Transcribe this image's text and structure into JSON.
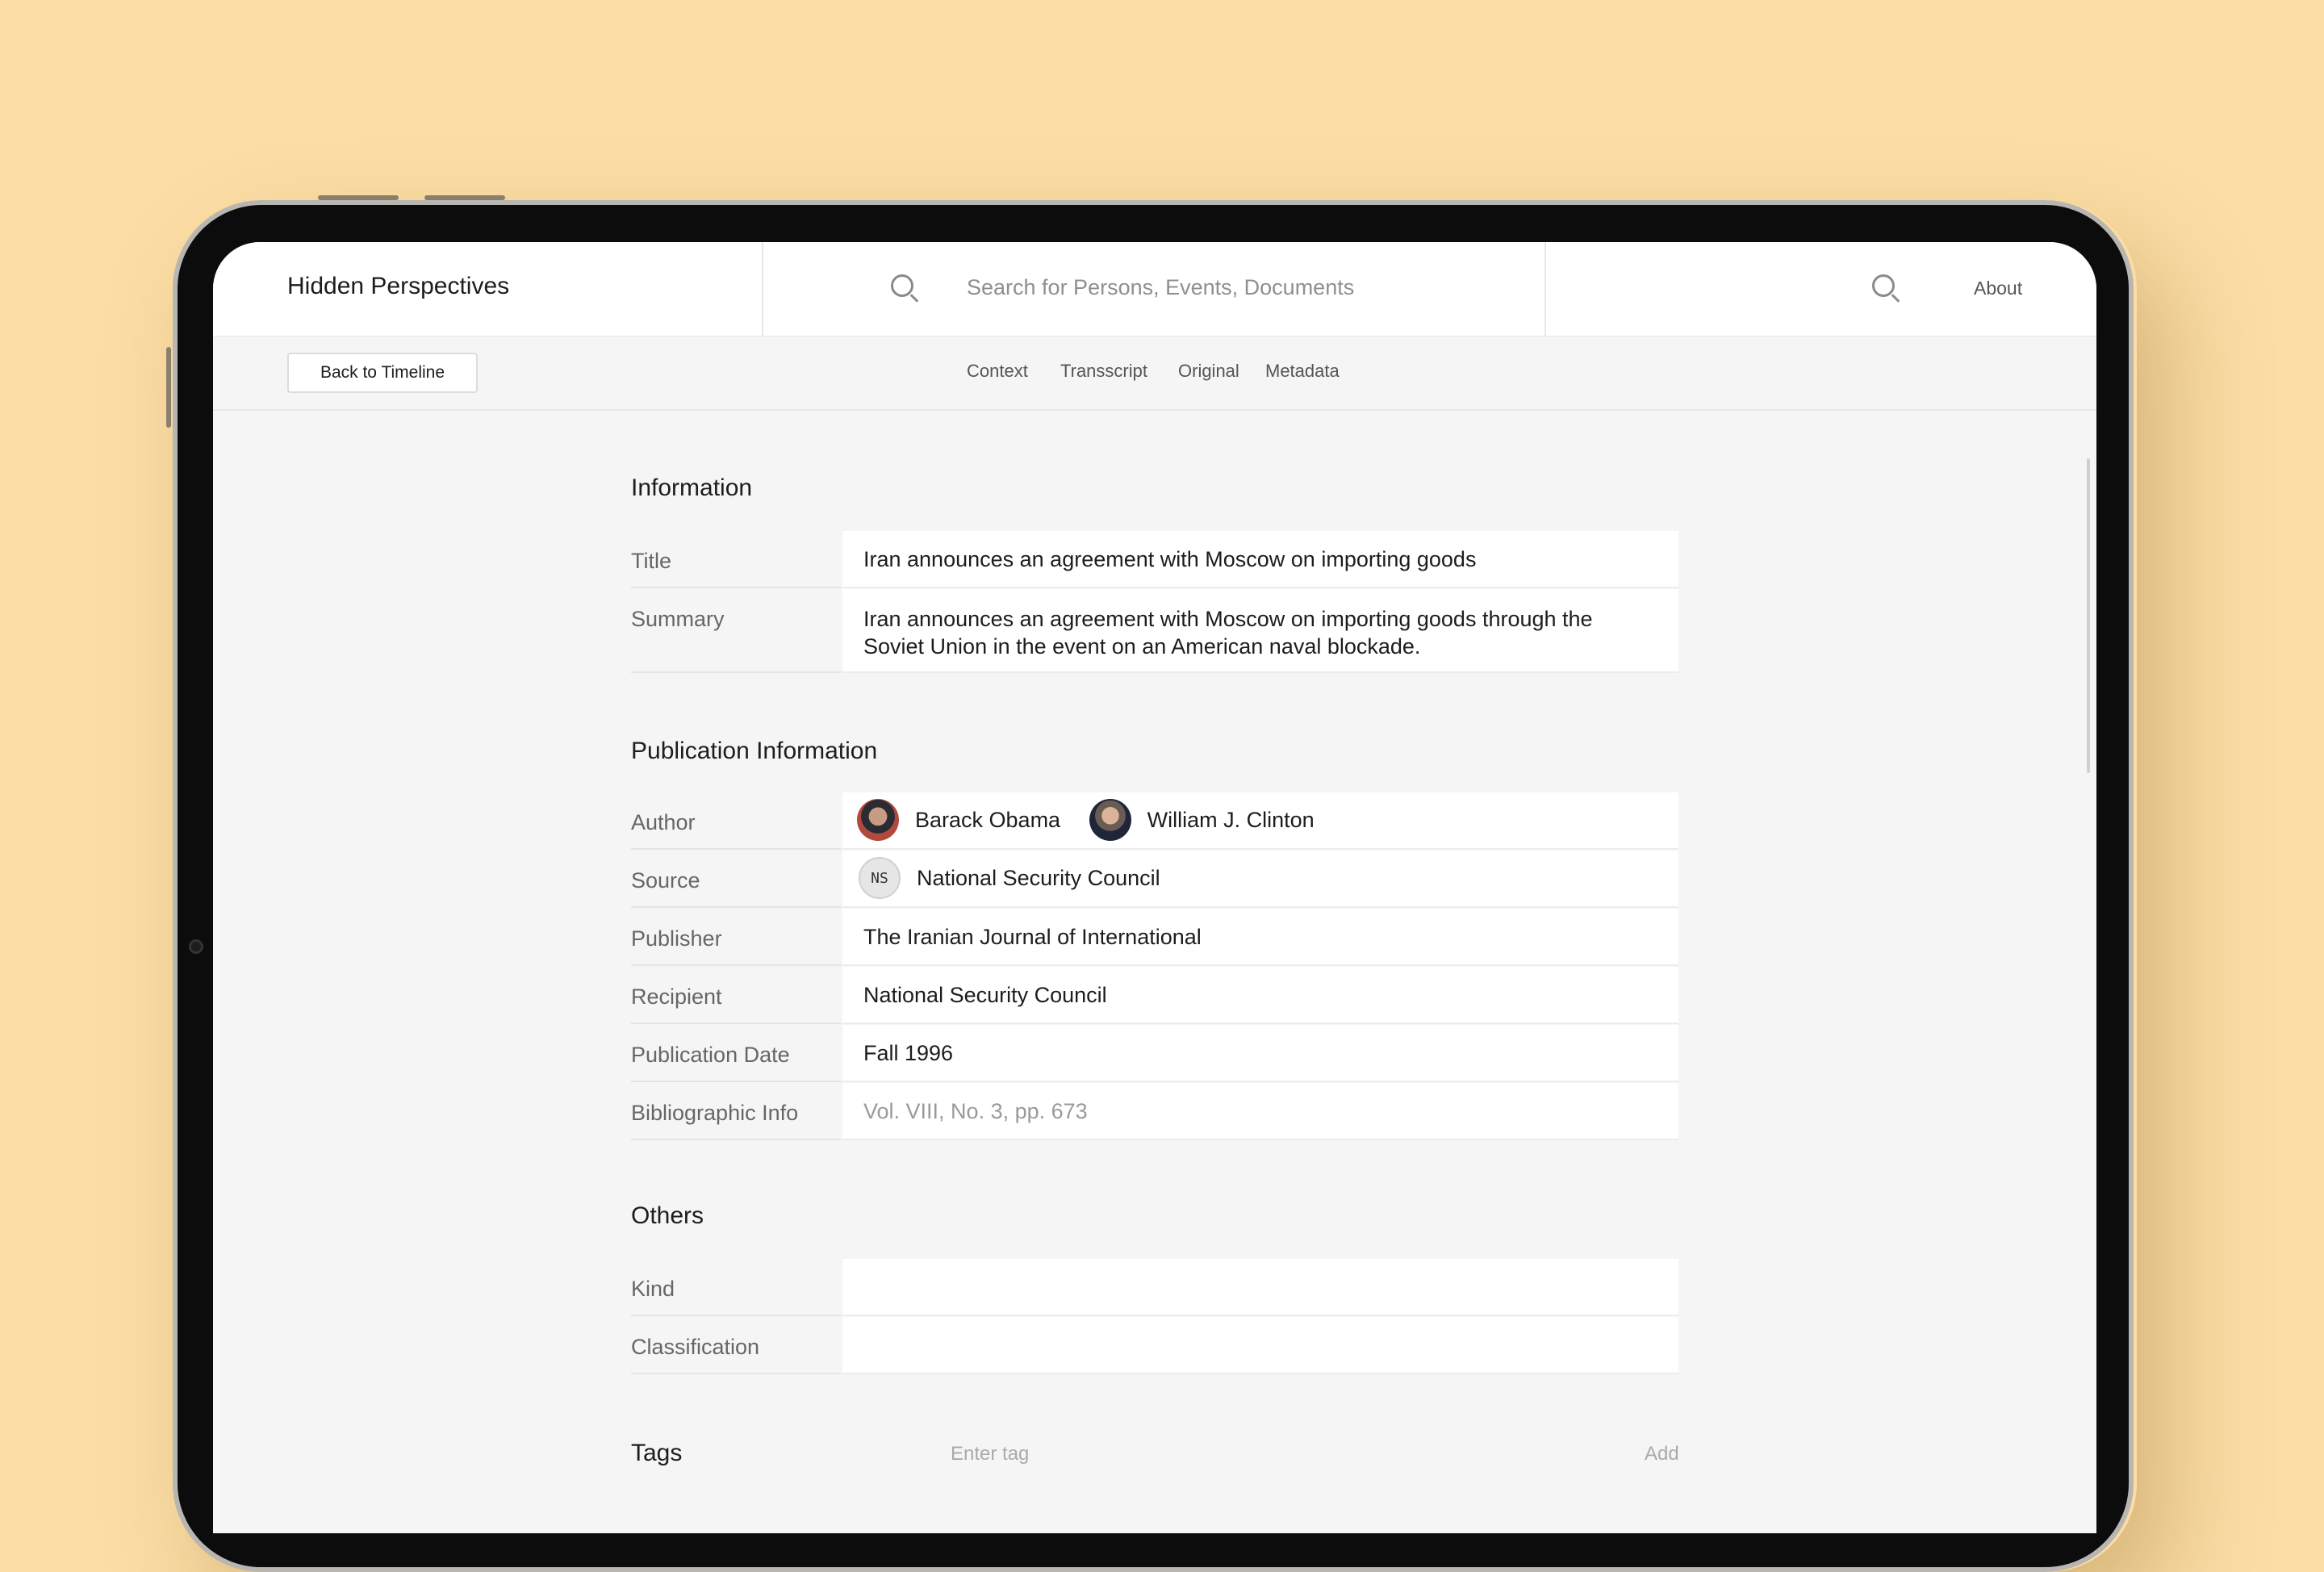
{
  "app": {
    "title": "Hidden Perspectives",
    "about_label": "About"
  },
  "search": {
    "placeholder": "Search for Persons, Events, Documents"
  },
  "nav": {
    "back_label": "Back to Timeline",
    "tabs": [
      "Context",
      "Transscript",
      "Original",
      "Metadata"
    ]
  },
  "information": {
    "heading": "Information",
    "title_label": "Title",
    "title_value": "Iran announces an agreement with Moscow on importing goods",
    "summary_label": "Summary",
    "summary_value": "Iran announces an agreement with Moscow on importing goods through the Soviet Union in the event on an American naval blockade."
  },
  "publication": {
    "heading": "Publication Information",
    "author_label": "Author",
    "authors": [
      "Barack Obama",
      "William J. Clinton"
    ],
    "source_label": "Source",
    "source_initials": "NS",
    "source_value": "National Security Council",
    "publisher_label": "Publisher",
    "publisher_value": "The Iranian Journal of International",
    "recipient_label": "Recipient",
    "recipient_value": "National Security Council",
    "date_label": "Publication Date",
    "date_value": "Fall 1996",
    "biblio_label": "Bibliographic Info",
    "biblio_placeholder": "Vol. VIII, No. 3, pp. 673"
  },
  "others": {
    "heading": "Others",
    "kind_label": "Kind",
    "kind_value": "",
    "classification_label": "Classification",
    "classification_value": ""
  },
  "tags": {
    "heading": "Tags",
    "input_placeholder": "Enter tag",
    "add_label": "Add"
  },
  "colors": {
    "background": "#fbdda5",
    "surface": "#f5f5f5",
    "field": "#ffffff"
  }
}
